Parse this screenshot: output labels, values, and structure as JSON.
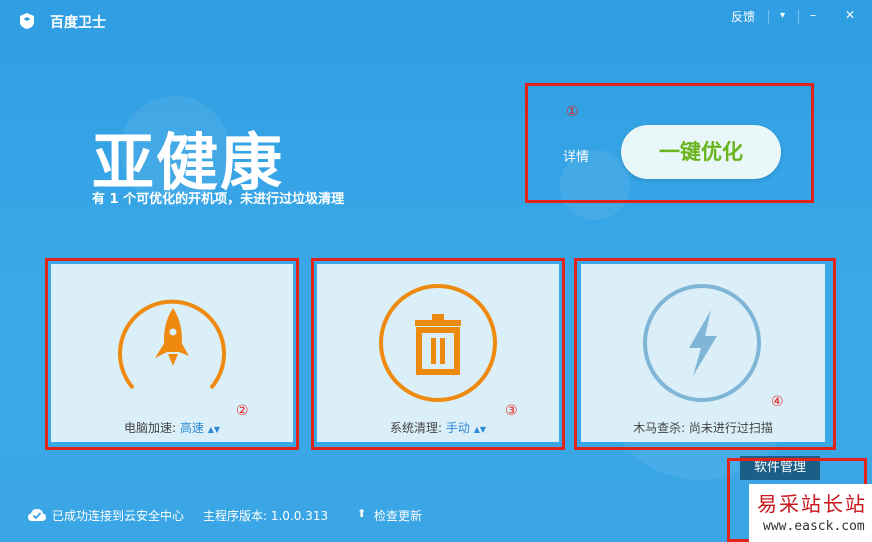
{
  "app": {
    "title": "百度卫士"
  },
  "window": {
    "feedback": "反馈",
    "menu_glyph": "▾",
    "minimize_glyph": "–",
    "close_glyph": "✕"
  },
  "status": {
    "title": "亚健康",
    "description": "有 1 个可优化的开机项，未进行过垃圾清理"
  },
  "optimize": {
    "details_label": "详情",
    "button_label": "一键优化"
  },
  "annotations": [
    "①",
    "②",
    "③",
    "④"
  ],
  "cards": [
    {
      "label": "电脑加速:",
      "value": "高速",
      "icon": "rocket-icon",
      "color": "#ee8a0f"
    },
    {
      "label": "系统清理:",
      "value": "手动",
      "icon": "trash-icon",
      "color": "#ee8a0f"
    },
    {
      "label": "木马查杀: 尚未进行过扫描",
      "value": "",
      "icon": "lightning-icon",
      "color": "#7fb6d6"
    }
  ],
  "footer": {
    "cloud_status": "已成功连接到云安全中心",
    "version": "主程序版本: 1.0.0.313",
    "update": "检查更新",
    "software_manager": "软件管理"
  },
  "watermark": {
    "text": "易采站长站",
    "url": "www.easck.com"
  }
}
